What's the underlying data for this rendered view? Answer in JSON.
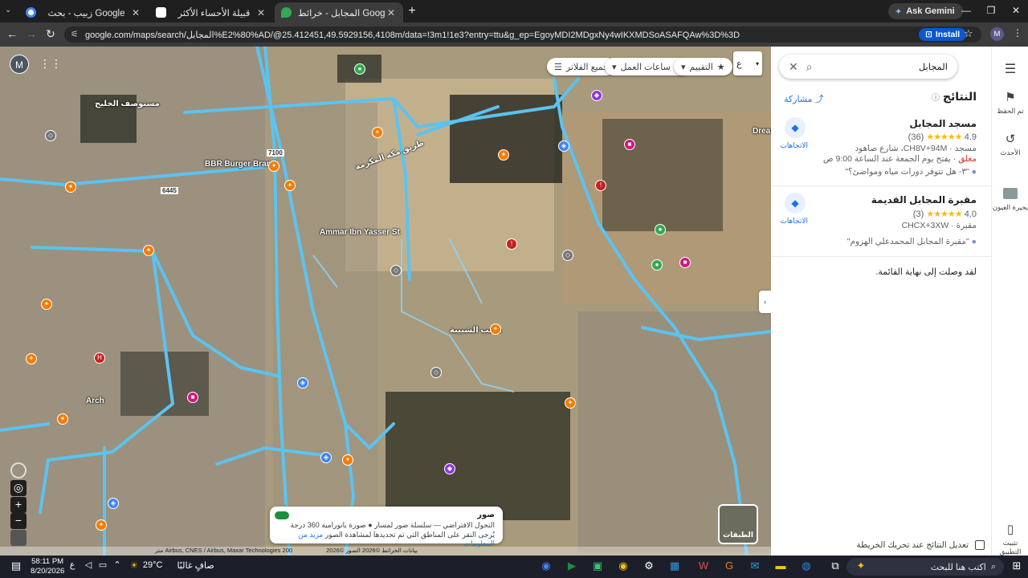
{
  "browser": {
    "tabs": [
      {
        "title": "زبيب - بحث Google",
        "active": false
      },
      {
        "title": "قبيلة الأحساء الأكثر",
        "active": false
      },
      {
        "title": "المجابل - خرائط Google",
        "active": true
      }
    ],
    "gemini_label": "Ask Gemini",
    "url": "google.com/maps/search/المجابل%E2%80%AD/@25.412451,49.5929156,4108m/data=!3m1!1e3?entry=ttu&g_ep=EgoyMDI2MDgxNy4wIKXMDSoASAFQAw%3D%3D",
    "install_label": "Install",
    "profile_initial": "M"
  },
  "map": {
    "user_initial": "M",
    "lang_label": "ع",
    "chips": {
      "all_filters": "جميع الفلاتر",
      "hours": "ساعات العمل",
      "rating": "التقييم"
    },
    "labels": {
      "hospital": "مستوصف الخليج",
      "burger": "BBR Burger Brand",
      "street": "Ammar Ibn Yasser St",
      "dream": "Dream",
      "arch": "Arch",
      "shabiba": "ملعب الشبيبة",
      "makkah_st": "طريق مكة المكرمة",
      "road_7100": "7100",
      "road_6445": "6445"
    },
    "photo_panel": {
      "title": "صور",
      "legend": "التجول الافتراضي ― سلسلة صور لمسار ● صورة بانورامية 360 درجة",
      "hint": "يُرجى النقر على المناطق التي تم تحديدها لمشاهدة الصور",
      "link": "مزيد من المعلومات"
    },
    "layers_label": "الطبقات",
    "attribution": "بيانات الخرائط ©2026 الصور ©2026 Airbus, CNES / Airbus, Maxar Technologies",
    "scale": "200 متر"
  },
  "panel": {
    "search_query": "المجابل",
    "results_heading": "النتائج",
    "share_label": "مشاركة",
    "results": [
      {
        "name": "مسجد المجابل",
        "rating": "4.9",
        "stars": "★★★★★",
        "reviews": "(36)",
        "type_address": "مسجد · CH8V+94M، شارع صاهود",
        "status_closed": "مغلق",
        "status_rest": " · يفتح يوم الجمعة عند الساعة 9:00 ص",
        "review_snippet": "\"٣- هل تتوفر دورات مياه ومواضئ؟\"",
        "directions_label": "الاتجاهات"
      },
      {
        "name": "مقبرة المجابل القديمة",
        "rating": "4.0",
        "stars": "★★★★★",
        "reviews": "(3)",
        "type_address": "مقبرة · CHCX+3XW",
        "review_snippet": "\"مقبرة المجابل المحمدعلي الهزوم\"",
        "directions_label": "الاتجاهات"
      }
    ],
    "end_of_list": "لقد وصلت إلى نهاية القائمة.",
    "update_on_move": "تعديل النتائج عند تحريك الخريطة"
  },
  "rail": {
    "saved": "تم الحفظ",
    "recent": "الأحدث",
    "lake": "بحيرة العيون",
    "install_app": "تثبيت التطبيق"
  },
  "taskbar": {
    "search_placeholder": "اكتب هنا للبحث",
    "weather_temp": "29°C",
    "weather_desc": "صافٍ غالبًا",
    "time": "58:11 PM",
    "date": "8/20/2026",
    "lang": "ع"
  }
}
